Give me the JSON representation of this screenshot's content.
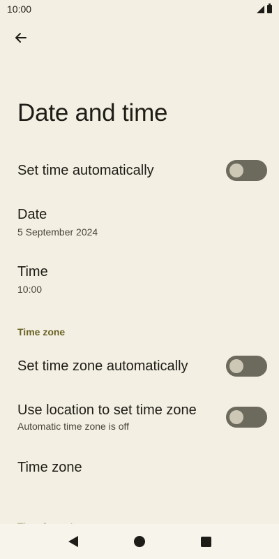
{
  "status_bar": {
    "time": "10:00"
  },
  "page": {
    "title": "Date and time"
  },
  "settings": {
    "set_time_auto": {
      "label": "Set time automatically",
      "enabled": false
    },
    "date": {
      "label": "Date",
      "value": "5 September 2024"
    },
    "time": {
      "label": "Time",
      "value": "10:00"
    },
    "time_zone_section": {
      "header": "Time zone"
    },
    "set_time_zone_auto": {
      "label": "Set time zone automatically",
      "enabled": false
    },
    "use_location": {
      "label": "Use location to set time zone",
      "summary": "Automatic time zone is off",
      "enabled": false
    },
    "time_zone": {
      "label": "Time zone"
    },
    "time_format_section": {
      "header": "Time format"
    }
  },
  "icons": {
    "back": "arrow-left",
    "signal": "cellular-signal",
    "battery": "battery",
    "nav_back": "triangle-left",
    "nav_home": "circle",
    "nav_recent": "square"
  },
  "colors": {
    "background": "#f3efe3",
    "accent": "#6b6426",
    "toggle_off_track": "#6c6a5c"
  }
}
